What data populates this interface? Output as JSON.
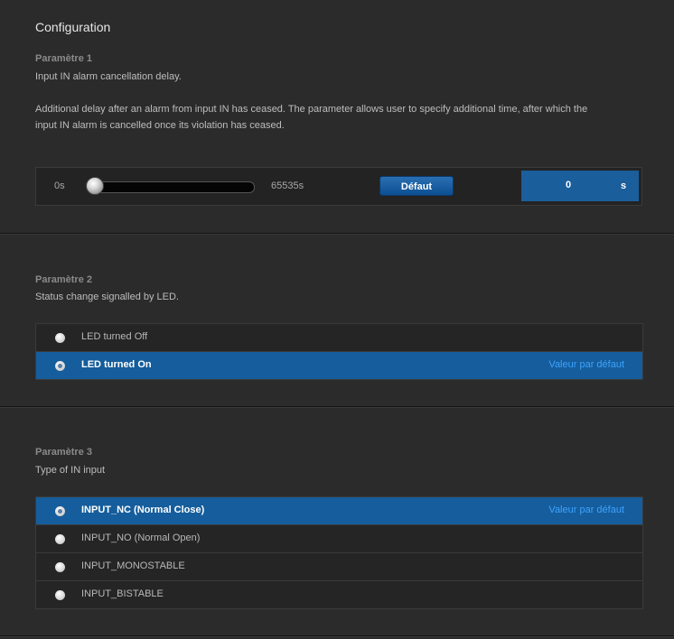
{
  "page_title": "Configuration",
  "param1": {
    "heading": "Paramètre 1",
    "description": "Input IN alarm cancellation delay.",
    "detail_line1": "Additional delay after an alarm from input IN has ceased. The parameter allows user to specify additional time, after which the",
    "detail_line2": "input IN alarm is cancelled once its violation has ceased.",
    "slider": {
      "min_label": "0s",
      "max_label": "65535s",
      "min": 0,
      "max": 65535,
      "value": 0
    },
    "default_button_label": "Défaut",
    "value": "0",
    "unit": "s"
  },
  "param2": {
    "heading": "Paramètre 2",
    "description": "Status change signalled by LED.",
    "options": [
      {
        "label": "LED turned Off",
        "selected": false,
        "default_note": ""
      },
      {
        "label": "LED turned On",
        "selected": true,
        "default_note": "Valeur par défaut"
      }
    ]
  },
  "param3": {
    "heading": "Paramètre 3",
    "description": "Type of IN input",
    "options": [
      {
        "label": "INPUT_NC (Normal Close)",
        "selected": true,
        "default_note": "Valeur par défaut"
      },
      {
        "label": "INPUT_NO (Normal Open)",
        "selected": false,
        "default_note": ""
      },
      {
        "label": "INPUT_MONOSTABLE",
        "selected": false,
        "default_note": ""
      },
      {
        "label": "INPUT_BISTABLE",
        "selected": false,
        "default_note": ""
      }
    ]
  },
  "colors": {
    "accent": "#155d9c",
    "default_note": "#3ea3ff",
    "background": "#2b2b2b"
  }
}
